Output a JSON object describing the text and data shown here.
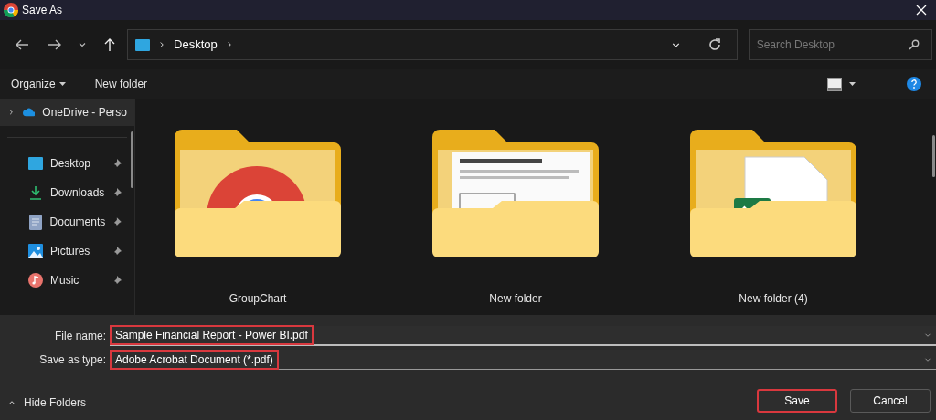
{
  "window": {
    "title": "Save As"
  },
  "address_bar": {
    "crumbs": [
      "Desktop"
    ]
  },
  "search": {
    "placeholder": "Search Desktop"
  },
  "toolbar": {
    "organize": "Organize",
    "new_folder": "New folder"
  },
  "sidebar": {
    "top_item": {
      "label": "OneDrive - Perso",
      "expanded": false
    },
    "items": [
      {
        "label": "Desktop",
        "kind": "desktop",
        "pinned": true
      },
      {
        "label": "Downloads",
        "kind": "downloads",
        "pinned": true
      },
      {
        "label": "Documents",
        "kind": "documents",
        "pinned": true
      },
      {
        "label": "Pictures",
        "kind": "pictures",
        "pinned": true
      },
      {
        "label": "Music",
        "kind": "music",
        "pinned": true
      }
    ]
  },
  "folders": [
    {
      "name": "GroupChart",
      "kind": "chrome"
    },
    {
      "name": "New folder",
      "kind": "document"
    },
    {
      "name": "New folder (4)",
      "kind": "excel"
    }
  ],
  "form": {
    "file_name": {
      "label": "File name:",
      "value": "Sample Financial Report - Power BI.pdf",
      "highlighted": true
    },
    "save_as_type": {
      "label": "Save as type:",
      "value": "Adobe Acrobat Document (*.pdf)",
      "highlighted": true
    }
  },
  "hide_folders": "Hide Folders",
  "buttons": [
    {
      "label": "Save",
      "highlighted": true
    },
    {
      "label": "Cancel",
      "highlighted": false
    }
  ]
}
